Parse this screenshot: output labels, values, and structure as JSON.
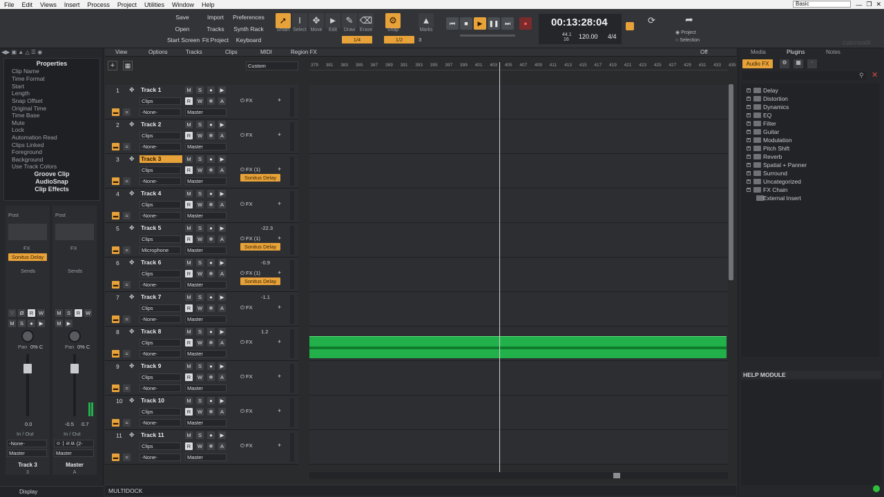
{
  "menu": [
    "File",
    "Edit",
    "Views",
    "Insert",
    "Process",
    "Project",
    "Utilities",
    "Window",
    "Help"
  ],
  "workspace": "Basic",
  "control_bar": {
    "file_buttons": [
      "Save",
      "Import",
      "Preferences",
      "Open",
      "Tracks",
      "Synth Rack",
      "Start Screen",
      "Fit Project",
      "Keyboard"
    ],
    "tools": [
      "Smart",
      "Select",
      "Move",
      "Edit",
      "Draw",
      "Erase"
    ],
    "snap_label": "Snap",
    "snap_value": "1/4",
    "marks_label": "Marks",
    "marks_value": "1/2",
    "marks_num": "3",
    "time": "00:13:28:04",
    "sample_rate": "44.1",
    "bit_depth": "16",
    "tempo": "120.00",
    "meter": "4/4",
    "project_radio": "Project",
    "selection_radio": "Selection",
    "brand": "cakewalk"
  },
  "inspector": {
    "properties_title": "Properties",
    "properties": [
      "Clip Name",
      "Time Format",
      "Start",
      "Length",
      "Snap Offset",
      "Original Time",
      "Time Base",
      "Mute",
      "Lock",
      "Automation Read",
      "Clips Linked",
      "Foreground",
      "Background",
      "Use Track Colors"
    ],
    "sections": [
      "Groove Clip",
      "AudioSnap",
      "Clip Effects"
    ],
    "strip_left": {
      "name": "Track 3",
      "num": "3",
      "fx": "FX",
      "plugin": "Sonitus Delay",
      "sends": "Sends",
      "pan": "Pan",
      "pan_value": "0% C",
      "input": "-None-",
      "output": "Master",
      "vol": "0.0",
      "inout": "In / Out",
      "post": "Post"
    },
    "strip_right": {
      "name": "Master",
      "num": "A",
      "fx": "FX",
      "sends": "Sends",
      "pan": "Pan",
      "pan_value": "0% C",
      "input": "ㅇㅣㄹㅉ (2-",
      "output": "Master",
      "vol_l": "-0.5",
      "vol_r": "0.7",
      "inout": "In / Out",
      "post": "Post"
    },
    "display_label": "Display"
  },
  "trackview": {
    "menus": [
      "View",
      "Options",
      "Tracks",
      "Clips",
      "MIDI",
      "Region FX"
    ],
    "custom_label": "Custom",
    "off_label": "Off",
    "ruler": [
      "379",
      "381",
      "383",
      "385",
      "387",
      "389",
      "391",
      "393",
      "395",
      "397",
      "399",
      "401",
      "403",
      "405",
      "407",
      "409",
      "411",
      "413",
      "415",
      "417",
      "419",
      "421",
      "423",
      "425",
      "427",
      "429",
      "431",
      "433",
      "435"
    ],
    "tracks": [
      {
        "num": "1",
        "name": "Track 1",
        "fx": "FX",
        "input": "-None-",
        "output": "Master",
        "clips": "Clips",
        "vol": "",
        "plugin": ""
      },
      {
        "num": "2",
        "name": "Track 2",
        "fx": "FX",
        "input": "-None-",
        "output": "Master",
        "clips": "Clips",
        "vol": "",
        "plugin": ""
      },
      {
        "num": "3",
        "name": "Track 3",
        "fx": "FX (1)",
        "input": "-None-",
        "output": "Master",
        "clips": "Clips",
        "vol": "",
        "plugin": "Sonitus Delay",
        "selected": true
      },
      {
        "num": "4",
        "name": "Track 4",
        "fx": "FX",
        "input": "-None-",
        "output": "Master",
        "clips": "Clips",
        "vol": "",
        "plugin": ""
      },
      {
        "num": "5",
        "name": "Track 5",
        "fx": "FX (1)",
        "input": "Microphone",
        "output": "Master",
        "clips": "Clips",
        "vol": "-22.3",
        "plugin": "Sonitus Delay"
      },
      {
        "num": "6",
        "name": "Track 6",
        "fx": "FX (1)",
        "input": "-None-",
        "output": "Master",
        "clips": "Clips",
        "vol": "-0.9",
        "plugin": "Sonitus Delay"
      },
      {
        "num": "7",
        "name": "Track 7",
        "fx": "FX",
        "input": "-None-",
        "output": "Master",
        "clips": "Clips",
        "vol": "-1.1",
        "plugin": ""
      },
      {
        "num": "8",
        "name": "Track 8",
        "fx": "FX",
        "input": "-None-",
        "output": "Master",
        "clips": "Clips",
        "vol": "1.2",
        "plugin": ""
      },
      {
        "num": "9",
        "name": "Track 9",
        "fx": "FX",
        "input": "-None-",
        "output": "Master",
        "clips": "Clips",
        "vol": "",
        "plugin": ""
      },
      {
        "num": "10",
        "name": "Track 10",
        "fx": "FX",
        "input": "-None-",
        "output": "Master",
        "clips": "Clips",
        "vol": "",
        "plugin": ""
      },
      {
        "num": "11",
        "name": "Track 11",
        "fx": "FX",
        "input": "-None-",
        "output": "Master",
        "clips": "Clips",
        "vol": "",
        "plugin": ""
      }
    ],
    "multidock": "MULTIDOCK"
  },
  "browser": {
    "tabs": [
      "Media",
      "Plugins",
      "Notes"
    ],
    "active_category": "Audio FX",
    "items": [
      "Delay",
      "Distortion",
      "Dynamics",
      "EQ",
      "Filter",
      "Guitar",
      "Modulation",
      "Pitch Shift",
      "Reverb",
      "Spatial + Panner",
      "Surround",
      "Uncategorized",
      "FX Chain",
      "External Insert"
    ],
    "help_title": "HELP MODULE"
  },
  "colors": {
    "accent": "#e8a23a",
    "clip_green": "#22b04a",
    "bg": "#2a2b2d"
  }
}
